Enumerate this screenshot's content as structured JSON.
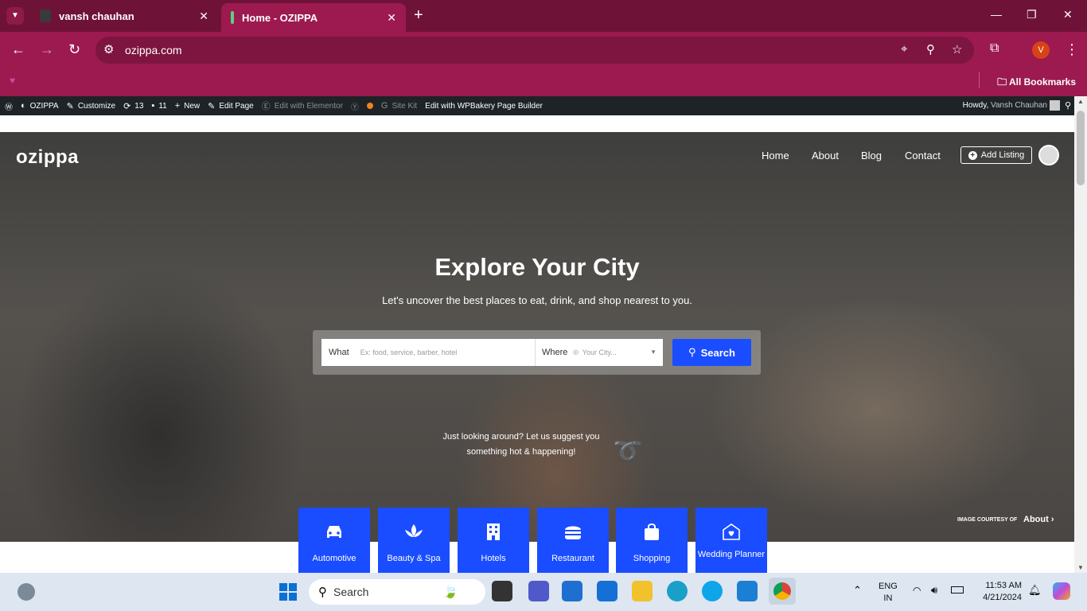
{
  "browser": {
    "tabs": [
      {
        "title": "vansh chauhan",
        "active": false
      },
      {
        "title": "Home - OZIPPA",
        "active": true
      }
    ],
    "url": "ozippa.com",
    "bookmarks_label": "All Bookmarks",
    "profile_initial": "V",
    "colors": {
      "frame": "#6f1238",
      "toolbar": "#9c1a50"
    }
  },
  "wp_admin_bar": {
    "items": [
      "OZIPPA",
      "Customize",
      "13",
      "11",
      "New",
      "Edit Page",
      "Edit with Elementor",
      "Site Kit",
      "Edit with WPBakery Page Builder"
    ],
    "howdy_prefix": "Howdy,",
    "howdy_name": "Vansh Chauhan"
  },
  "site": {
    "logo": "ozippa",
    "nav": [
      "Home",
      "About",
      "Blog",
      "Contact"
    ],
    "add_listing": "Add Listing",
    "hero_title": "Explore Your City",
    "hero_subtitle": "Let's uncover the best places to eat, drink, and shop nearest to you.",
    "search": {
      "what_label": "What",
      "what_placeholder": "Ex: food, service, barber, hotel",
      "where_label": "Where",
      "where_placeholder": "Your City...",
      "button": "Search"
    },
    "suggest_line1": "Just looking around? Let us suggest you",
    "suggest_line2": "something hot & happening!",
    "courtesy_label": "IMAGE COURTESY OF",
    "courtesy_link": "About",
    "categories": [
      {
        "label": "Automotive",
        "icon": "car-icon"
      },
      {
        "label": "Beauty & Spa",
        "icon": "lotus-icon"
      },
      {
        "label": "Hotels",
        "icon": "building-icon"
      },
      {
        "label": "Restaurant",
        "icon": "burger-icon"
      },
      {
        "label": "Shopping",
        "icon": "shopping-bag-icon"
      },
      {
        "label": "Wedding Planner",
        "icon": "wedding-icon"
      }
    ],
    "accent_color": "#1a4dff"
  },
  "taskbar": {
    "search_label": "Search",
    "lang_line1": "ENG",
    "lang_line2": "IN",
    "time": "11:53 AM",
    "date": "4/21/2024"
  }
}
